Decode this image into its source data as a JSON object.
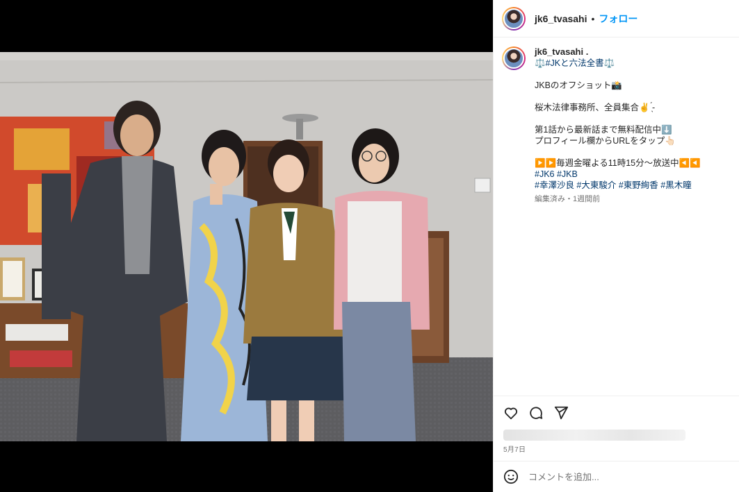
{
  "header": {
    "username": "jk6_tvasahi",
    "separator": "•",
    "follow_label": "フォロー"
  },
  "caption": {
    "username": "jk6_tvasahi .",
    "lines": [
      "⚖️#JKと六法全書⚖️",
      "",
      "JKBのオフショット📸",
      "",
      "桜木法律事務所、全員集合✌️ ̖́-",
      "",
      "第1話から最新話まで無料配信中⬇️",
      "プロフィール欄からURLをタップ👆🏻",
      "",
      "▶️▶️毎週金曜よる11時15分〜放送中◀️◀️"
    ],
    "hashtags_line1": "#JK6 #JKB",
    "hashtags_line2": "#幸澤沙良 #大東駿介 #東野絢香 #黒木瞳",
    "meta": "編集済み・1週間前"
  },
  "actions": {
    "like_icon": "heart-icon",
    "comment_icon": "comment-icon",
    "share_icon": "share-icon",
    "date": "5月7日"
  },
  "comment": {
    "emoji_icon": "emoji-icon",
    "placeholder": "コメントを追加..."
  },
  "photo": {
    "tag_icon": "user-tag-icon"
  }
}
